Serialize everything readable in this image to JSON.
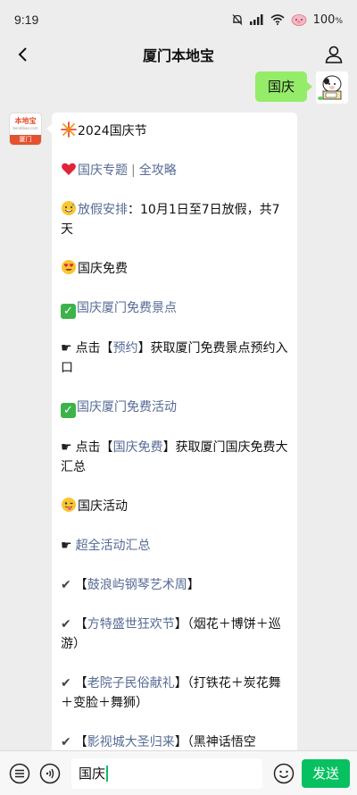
{
  "status_bar": {
    "time": "9:19",
    "battery": "100",
    "battery_unit": "%"
  },
  "nav": {
    "title": "厦门本地宝"
  },
  "outgoing": {
    "text": "国庆"
  },
  "incoming_avatar": {
    "top": "本地宝",
    "url": "bendibao.com",
    "city": "厦门"
  },
  "message": {
    "line1": "2024国庆节",
    "line2_a": "国庆专题",
    "line2_sep": "|",
    "line2_b": "全攻略",
    "line3_label": "放假安排",
    "line3_text": "：10月1日至7日放假，共7天",
    "line4": "国庆免费",
    "line5": "国庆厦门免费景点",
    "line6_pre": "点击【",
    "line6_link": "预约",
    "line6_post": "】获取厦门免费景点预约入口",
    "line7": "国庆厦门免费活动",
    "line8_pre": "点击【",
    "line8_link": "国庆免费",
    "line8_post": "】获取厦门国庆免费大汇总",
    "line9": "国庆活动",
    "line10": "超全活动汇总",
    "item1_link": "鼓浪屿钢琴艺术周",
    "item2_link": "方特盛世狂欢节",
    "item2_post": "（烟花＋博饼＋巡游）",
    "item3_link": "老院子民俗献礼",
    "item3_post": "（打铁花＋炭花舞＋变脸＋舞狮）",
    "item4_link": "影视城大圣归来",
    "item4_post": "（黑神话悟空"
  },
  "input": {
    "value": "国庆",
    "send_label": "发送"
  },
  "colors": {
    "accent": "#07c160",
    "bubble_out": "#95ec69",
    "link": "#576b95"
  }
}
